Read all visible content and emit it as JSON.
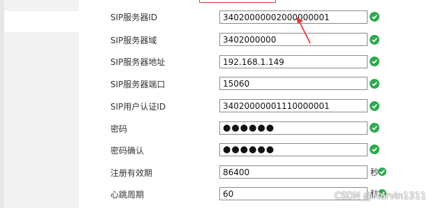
{
  "top_partial_label": "",
  "fields": [
    {
      "label": "SIP服务器ID",
      "value": "34020000002000000001",
      "type": "text",
      "status_icon": "check-circle-icon"
    },
    {
      "label": "SIP服务器域",
      "value": "3402000000",
      "type": "text",
      "status_icon": "check-circle-icon"
    },
    {
      "label": "SIP服务器地址",
      "value": "192.168.1.149",
      "type": "text",
      "status_icon": "check-circle-icon"
    },
    {
      "label": "SIP服务器端口",
      "value": "15060",
      "type": "text",
      "status_icon": "check-circle-icon"
    },
    {
      "label": "SIP用户认证ID",
      "value": "34020000001110000001",
      "type": "text",
      "status_icon": "check-circle-icon"
    },
    {
      "label": "密码",
      "value": "●●●●●●",
      "type": "password",
      "status_icon": "check-circle-icon"
    },
    {
      "label": "密码确认",
      "value": "●●●●●●",
      "type": "password",
      "status_icon": "check-circle-icon"
    },
    {
      "label": "注册有效期",
      "value": "86400",
      "type": "text",
      "unit": "秒",
      "status_icon": "check-circle-icon"
    },
    {
      "label": "心跳周期",
      "value": "60",
      "type": "text",
      "unit": "秒",
      "status_icon": "check-circle-icon"
    }
  ],
  "watermark": "CSDN @Marvin1311",
  "colors": {
    "ok": "#2fa84f",
    "annotation": "#e43b3b",
    "border": "#8a8a8a"
  }
}
